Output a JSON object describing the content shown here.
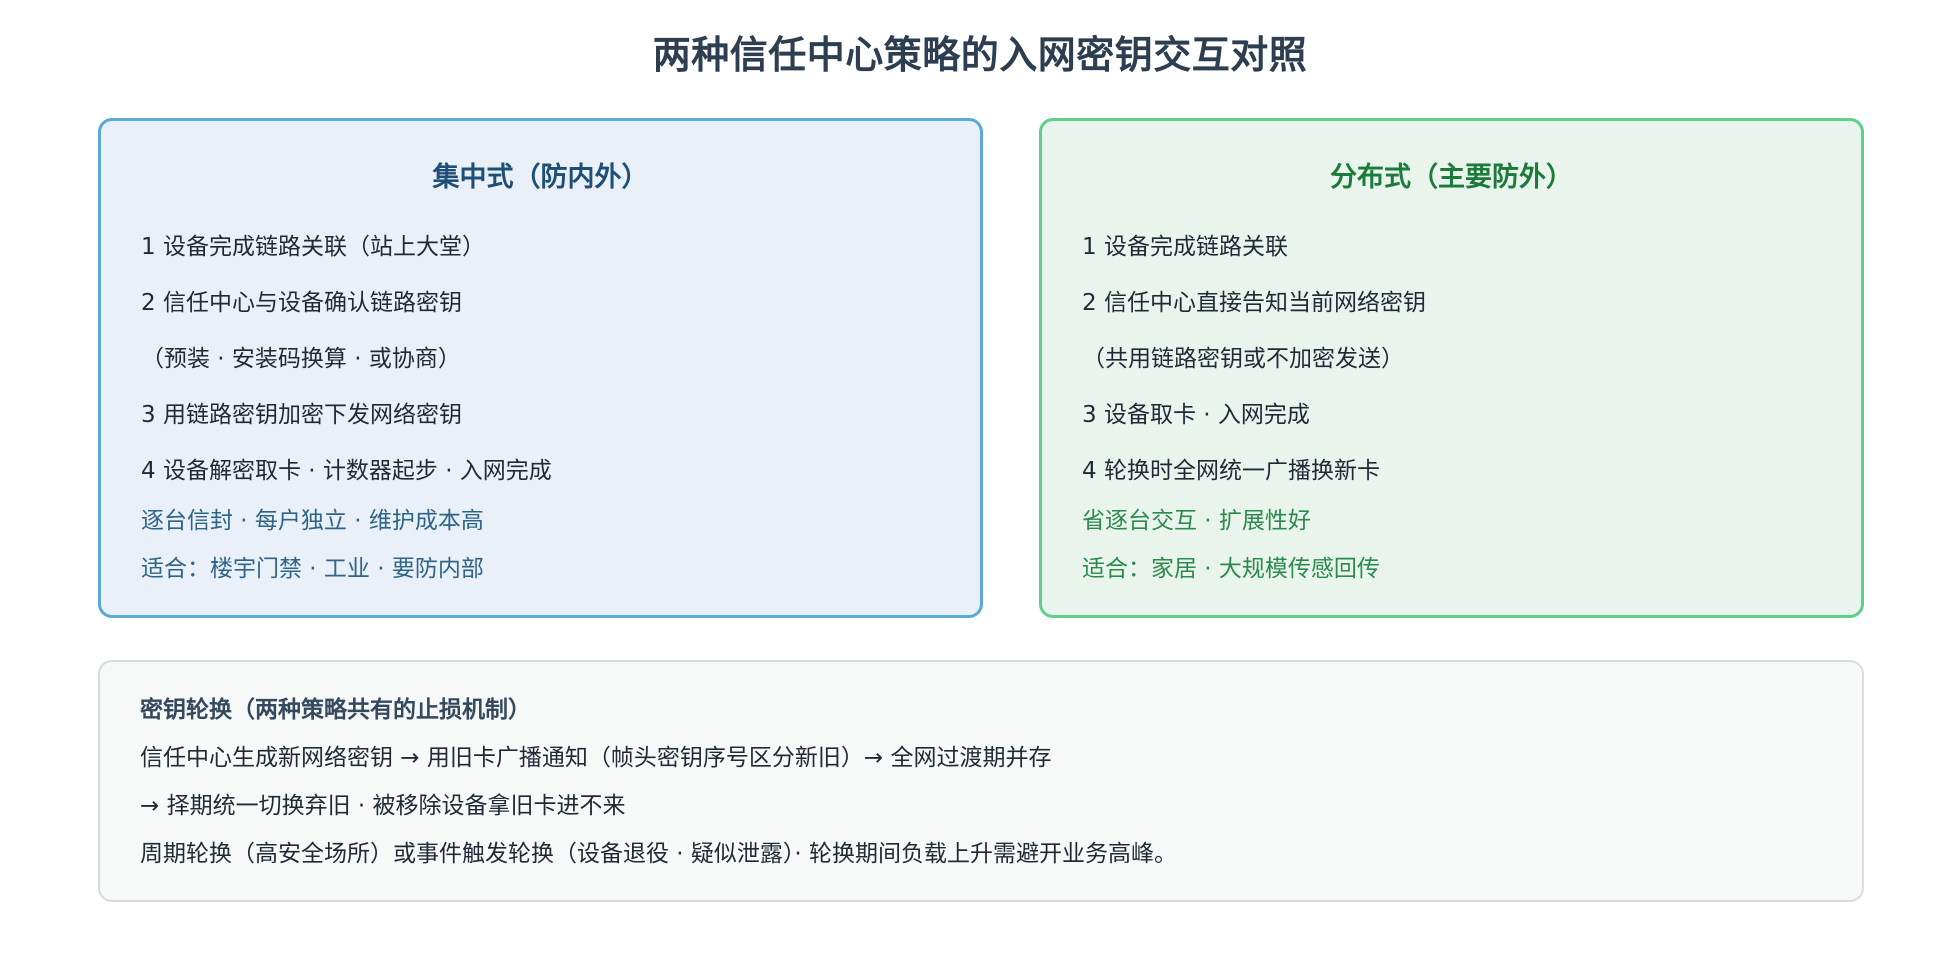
{
  "title": "两种信任中心策略的入网密钥交互对照",
  "central": {
    "title": "集中式（防内外）",
    "steps": [
      "1 设备完成链路关联（站上大堂）",
      "2 信任中心与设备确认链路密钥",
      "（预装 · 安装码换算 · 或协商）",
      "3 用链路密钥加密下发网络密钥",
      "4 设备解密取卡 · 计数器起步 · 入网完成"
    ],
    "notes": [
      "逐台信封 · 每户独立 · 维护成本高",
      "适合：楼宇门禁 · 工业 · 要防内部"
    ]
  },
  "distributed": {
    "title": "分布式（主要防外）",
    "steps": [
      "1 设备完成链路关联",
      "2 信任中心直接告知当前网络密钥",
      "（共用链路密钥或不加密发送）",
      "3 设备取卡 · 入网完成",
      "4 轮换时全网统一广播换新卡"
    ],
    "notes": [
      "省逐台交互 · 扩展性好",
      "适合：家居 · 大规模传感回传"
    ]
  },
  "rotation": {
    "title": "密钥轮换（两种策略共有的止损机制）",
    "lines": [
      "信任中心生成新网络密钥 → 用旧卡广播通知（帧头密钥序号区分新旧）→ 全网过渡期并存",
      "→ 择期统一切换弃旧 · 被移除设备拿旧卡进不来",
      "周期轮换（高安全场所）或事件触发轮换（设备退役 · 疑似泄露）· 轮换期间负载上升需避开业务高峰。"
    ]
  },
  "colors": {
    "central_border": "#5aa9d8",
    "central_bg": "#eaf0f7",
    "distributed_border": "#5fcf8c",
    "distributed_bg": "#e9f5ec",
    "rotation_border": "#d9dcdf",
    "rotation_bg": "#f7f8f8"
  }
}
